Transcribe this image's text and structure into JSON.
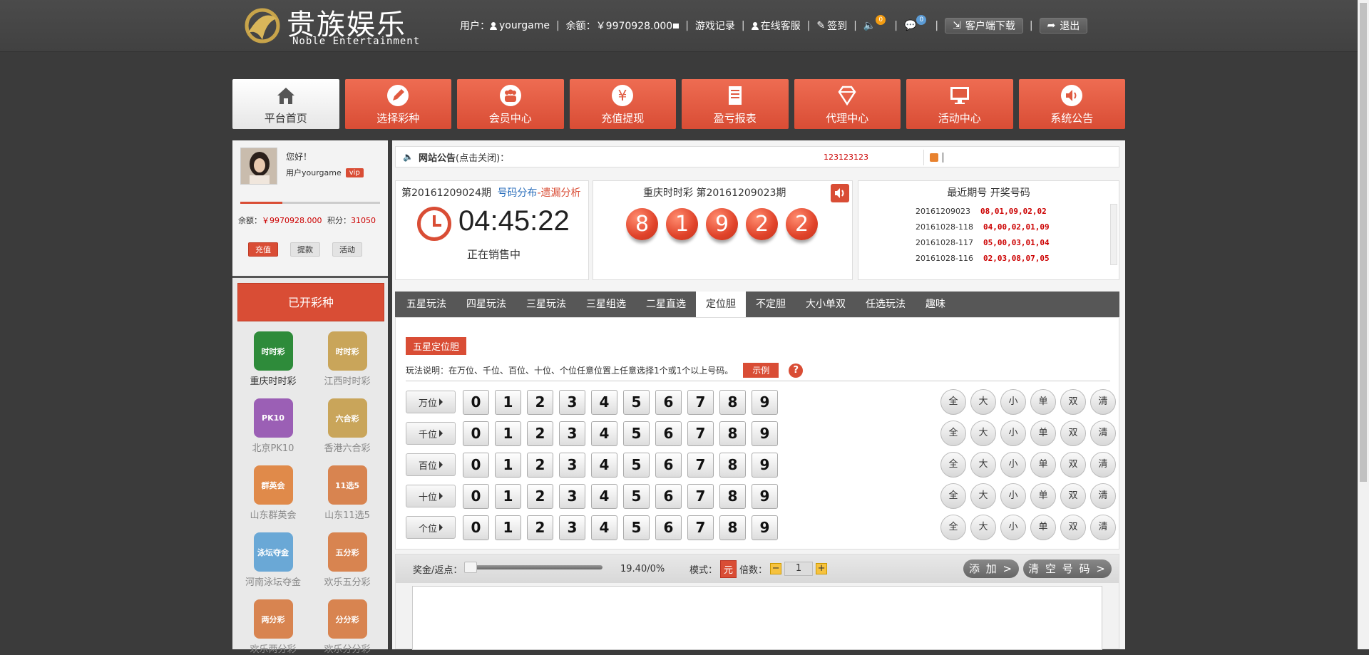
{
  "header": {
    "logo_cn": "贵族娱乐",
    "logo_en": "Noble Entertainment",
    "user_label": "用户：",
    "username": "yourgame",
    "balance_label": "余额：",
    "balance": "￥9970928.000",
    "game_record": "游戏记录",
    "online_service": "在线客服",
    "checkin": "签到",
    "notify_count": "0",
    "message_count": "0",
    "client_download": "客户端下载",
    "logout": "退出"
  },
  "nav": [
    {
      "label": "平台首页",
      "icon": "home-icon"
    },
    {
      "label": "选择彩种",
      "icon": "edit-icon"
    },
    {
      "label": "会员中心",
      "icon": "members-icon"
    },
    {
      "label": "充值提现",
      "icon": "yen-icon"
    },
    {
      "label": "盈亏报表",
      "icon": "report-icon"
    },
    {
      "label": "代理中心",
      "icon": "diamond-icon"
    },
    {
      "label": "活动中心",
      "icon": "monitor-icon"
    },
    {
      "label": "系统公告",
      "icon": "speaker-icon"
    }
  ],
  "sidebar": {
    "greeting": "您好！",
    "user_line": "用户yourgame",
    "vip": "vip",
    "level_progress": 0.3,
    "balance_label": "余额：",
    "balance": "￥9970928.000",
    "points_label": "积分：",
    "points": "31050",
    "buttons": [
      "充值",
      "提款",
      "活动"
    ],
    "opened_title": "已开彩种",
    "lotteries": [
      {
        "name": "重庆时时彩",
        "color": "#2e8b3a",
        "text": "时时彩"
      },
      {
        "name": "江西时时彩",
        "color": "#c9a55a",
        "text": "时时彩"
      },
      {
        "name": "北京PK10",
        "color": "#9b5fb5",
        "text": "PK10"
      },
      {
        "name": "香港六合彩",
        "color": "#c9a55a",
        "text": "六合彩"
      },
      {
        "name": "山东群英会",
        "color": "#e08a4a",
        "text": "群英会"
      },
      {
        "name": "山东11选5",
        "color": "#d88450",
        "text": "11选5"
      },
      {
        "name": "河南泳坛夺金",
        "color": "#6aa8d6",
        "text": "泳坛夺金"
      },
      {
        "name": "欢乐五分彩",
        "color": "#d88450",
        "text": "五分彩"
      },
      {
        "name": "欢乐两分彩",
        "color": "#d88450",
        "text": "两分彩"
      },
      {
        "name": "欢乐分分彩",
        "color": "#d88450",
        "text": "分分彩"
      }
    ]
  },
  "notice": {
    "title": "网站公告",
    "hint": "(点击关闭)：",
    "text": "123123123"
  },
  "current": {
    "issue": "第20161209024期",
    "link_dist": "号码分布",
    "dash": "-",
    "link_miss": "遗漏分析",
    "countdown": "04:45:22",
    "status": "正在销售中"
  },
  "last_draw": {
    "title": "重庆时时彩  第20161209023期",
    "balls": [
      "8",
      "1",
      "9",
      "2",
      "2"
    ]
  },
  "history": {
    "title": "最近期号  开奖号码",
    "rows": [
      {
        "issue": "20161209023",
        "nums": "08,01,09,02,02"
      },
      {
        "issue": "20161028-118",
        "nums": "04,00,02,01,09"
      },
      {
        "issue": "20161028-117",
        "nums": "05,00,03,01,04"
      },
      {
        "issue": "20161028-116",
        "nums": "02,03,08,07,05"
      }
    ]
  },
  "tabs": [
    "五星玩法",
    "四星玩法",
    "三星玩法",
    "三星组选",
    "二星直选",
    "定位胆",
    "不定胆",
    "大小单双",
    "任选玩法",
    "趣味"
  ],
  "play": {
    "mode_name": "五星定位胆",
    "description": "玩法说明：在万位、千位、百位、十位、个位任意位置上任意选择1个或1个以上号码。",
    "example": "示例",
    "help": "?",
    "positions": [
      "万位",
      "千位",
      "百位",
      "十位",
      "个位"
    ],
    "digits": [
      "0",
      "1",
      "2",
      "3",
      "4",
      "5",
      "6",
      "7",
      "8",
      "9"
    ],
    "quick": [
      "全",
      "大",
      "小",
      "单",
      "双",
      "清"
    ]
  },
  "bet": {
    "rebate_label": "奖金/返点：",
    "rebate": "19.40/0%",
    "mode_label": "模式：",
    "yuan": "元",
    "mult_label": "倍数：",
    "minus": "−",
    "mult": "1",
    "plus": "+",
    "add": "添 加 >",
    "clear": "清 空 号 码 >"
  }
}
